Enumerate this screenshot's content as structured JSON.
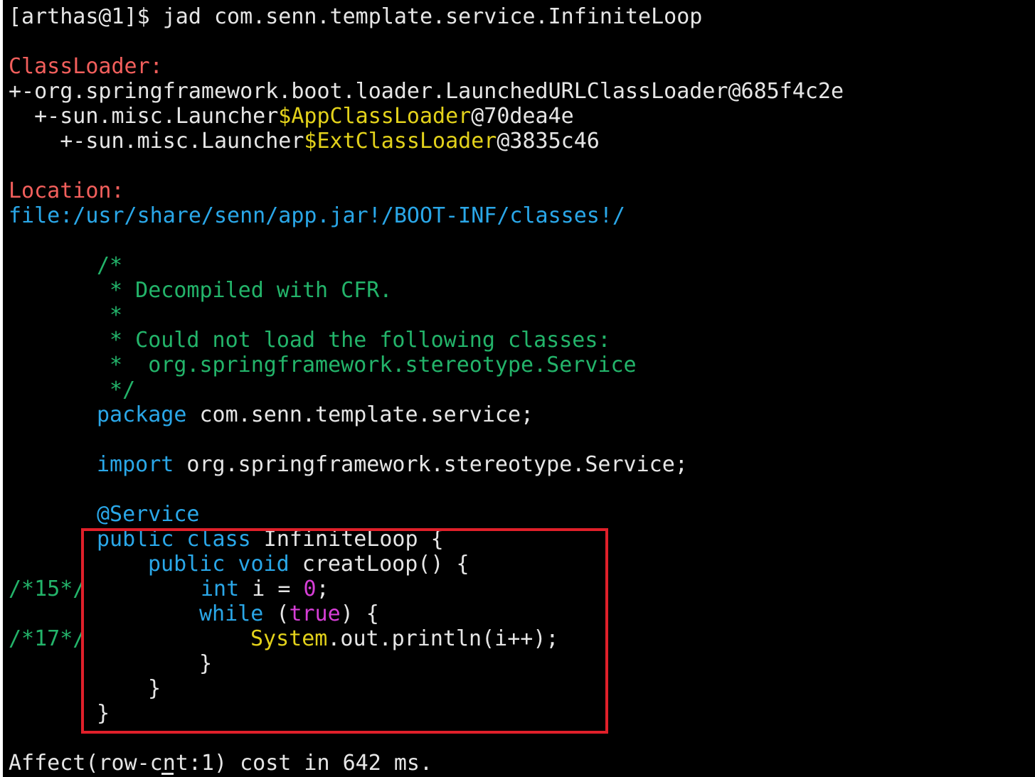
{
  "command": {
    "prompt": "[arthas@1]$ ",
    "text": "jad com.senn.template.service.InfiniteLoop"
  },
  "classloader": {
    "heading": "ClassLoader:",
    "entries": [
      {
        "prefix": "+-org.springframework.boot.loader.LaunchedURLClassLoader@685f4c2e",
        "highlight": "",
        "suffix": ""
      },
      {
        "prefix": "  +-sun.misc.Launcher",
        "highlight": "$AppClassLoader",
        "suffix": "@70dea4e"
      },
      {
        "prefix": "    +-sun.misc.Launcher",
        "highlight": "$ExtClassLoader",
        "suffix": "@3835c46"
      }
    ]
  },
  "location": {
    "heading": "Location:",
    "path": "file:/usr/share/senn/app.jar!/BOOT-INF/classes!/"
  },
  "source": {
    "comment_lines": [
      "/*",
      " * Decompiled with CFR.",
      " *",
      " * Could not load the following classes:",
      " *  org.springframework.stereotype.Service",
      " */"
    ],
    "package_kw": "package",
    "package_name": " com.senn.template.service;",
    "import_kw": "import",
    "import_name": " org.springframework.stereotype.Service;",
    "annotation": "@Service",
    "class_kw": "public class",
    "class_name": " InfiniteLoop {",
    "method_kw": "public void",
    "method_sig": " creatLoop() {",
    "line15_marker": "/*15*/",
    "int_kw": "int",
    "int_stmt_a": " i = ",
    "int_value": "0",
    "int_stmt_b": ";",
    "while_kw": "while",
    "while_paren_open": " (",
    "while_true": "true",
    "while_rest": ") {",
    "line17_marker": "/*17*/",
    "sysout_class": "System",
    "sysout_rest": ".out.println(i++);",
    "close_while": "}",
    "close_method": "}",
    "close_class": "}"
  },
  "result": {
    "text": "Affect(row-cnt:1) cost in 642 ms."
  },
  "colors": {
    "background": "#000000",
    "text": "#e6e6e6",
    "heading_red": "#f25f5c",
    "classloader_yellow": "#e3d21b",
    "keyword_blue": "#2aa7e8",
    "comment_green": "#23b46a",
    "literal_magenta": "#d63ed6",
    "highlight_box_red": "#e0202a"
  }
}
